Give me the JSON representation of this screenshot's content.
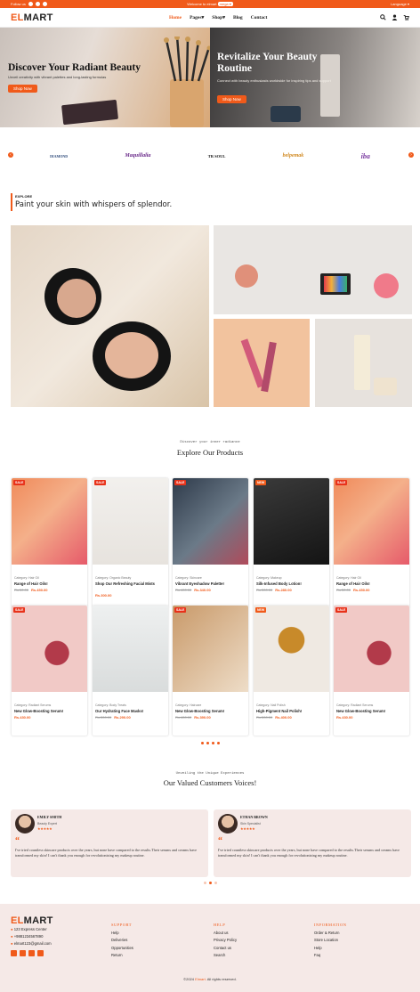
{
  "topbar": {
    "follow": "Follow us",
    "welcome": "Welcome to elmart",
    "welcome_btn": "mega ▾",
    "language": "Language ▾"
  },
  "nav": {
    "logo_e": "EL",
    "logo_rest": "MART",
    "items": [
      "Home",
      "Pages▾",
      "Shop▾",
      "Blog",
      "Contact"
    ]
  },
  "hero": [
    {
      "title": "Discover Your Radiant Beauty",
      "text": "Unveil creativity with vibrant palettes and long-lasting formulas",
      "button": "Shop Now"
    },
    {
      "title": "Revitalize Your Beauty Routine",
      "text": "Connect with beauty enthusiasts worldwide for inspiring tips and support",
      "button": "Shop Now"
    }
  ],
  "brands": [
    "DIAMOND",
    "Maquillalia",
    "TR SOUL",
    "belpemak",
    "iba"
  ],
  "explore": {
    "kicker": "EXPLORE",
    "title": "Paint your skin with whispers of splendor."
  },
  "products_section": {
    "subtitle": "Discover your inner radiance",
    "title": "Explore Our Products",
    "items": [
      {
        "badge": "SALE",
        "category": "Category: Hair Oil",
        "name": "Range of Hair Oils!",
        "old": "Rs.50.00",
        "price": "Rs.450.00",
        "img": "orange"
      },
      {
        "badge": "SALE",
        "category": "Category: Organic Beauty",
        "name": "Shop Our Refreshing Facial Mists",
        "old": "",
        "price": "Rs.300.00",
        "img": "plant"
      },
      {
        "badge": "SALE",
        "category": "Category: Skincare",
        "name": "Vibrant Eyeshadow Palette!",
        "old": "Rs.400.00",
        "price": "Rs.340.00",
        "img": "palette"
      },
      {
        "badge": "NEW",
        "category": "Category: Makeup",
        "name": "Silk-Infused Body Lotion!",
        "old": "Rs.300.00",
        "price": "Rs.280.00",
        "img": "dark"
      },
      {
        "badge": "SALE",
        "category": "Category: Hair Oil",
        "name": "Range of Hair Oils!",
        "old": "Rs.50.00",
        "price": "Rs.450.00",
        "img": "orange"
      },
      {
        "badge": "SALE",
        "category": "Category: Radiant Serums",
        "name": "New Glow-Boosting Serum!",
        "old": "",
        "price": "Rs.430.00",
        "img": "jars"
      },
      {
        "badge": "",
        "category": "Category: Body Treats",
        "name": "Our Hydrating Face Masks!",
        "old": "Rs.300.00",
        "price": "Rs.290.00",
        "img": "hands"
      },
      {
        "badge": "SALE",
        "category": "Category: Haircare",
        "name": "New Glow-Boosting Serum!",
        "old": "Rs.400.00",
        "price": "Rs.390.00",
        "img": "beige"
      },
      {
        "badge": "NEW",
        "category": "Category: Nail Polish",
        "name": "High-Pigment Nail Polish!",
        "old": "Rs.500.00",
        "price": "Rs.400.00",
        "img": "bottle"
      },
      {
        "badge": "SALE",
        "category": "Category: Radiant Serums",
        "name": "New Glow-Boosting Serum!",
        "old": "",
        "price": "Rs.430.00",
        "img": "jars"
      }
    ]
  },
  "testimonials": {
    "subtitle": "Unveiling the Unique Experiences",
    "title": "Our Valued Customers Voices!",
    "items": [
      {
        "name": "EMILY SMITH",
        "role": "Beauty Expert",
        "stars": "★★★★★",
        "text": "I've tried countless skincare products over the years, but none have compared to the results.Their serums and creams have transformed my skin! I can't thank you enough for revolutionizing my makeup routine."
      },
      {
        "name": "ETHAN BROWN",
        "role": "Skin Specialist",
        "stars": "★★★★★",
        "text": "I've tried countless skincare products over the years, but none have compared to the results.Their serums and creams have transformed my skin! I can't thank you enough for revolutionizing my makeup routine."
      }
    ]
  },
  "footer": {
    "logo_e": "EL",
    "logo_rest": "MART",
    "contact": [
      "123 Express Center",
      "+9881234567890",
      "elmart123@gmail.com"
    ],
    "columns": [
      {
        "heading": "SUPPORT",
        "links": [
          "Help",
          "Deliveries",
          "Opportunities",
          "Return"
        ]
      },
      {
        "heading": "HELP",
        "links": [
          "About us",
          "Privacy Policy",
          "Contact us",
          "Search"
        ]
      },
      {
        "heading": "INFORMATION",
        "links": [
          "Order & Return",
          "Store Location",
          "Help",
          "Faq"
        ]
      }
    ],
    "copy_pre": "©2024",
    "copy_brand": "Elmart.",
    "copy_post": "All rights reserved."
  },
  "colors": {
    "accent": "#f05a1a",
    "new_badge": "#f05a1a",
    "sale_badge": "#e8321a"
  }
}
